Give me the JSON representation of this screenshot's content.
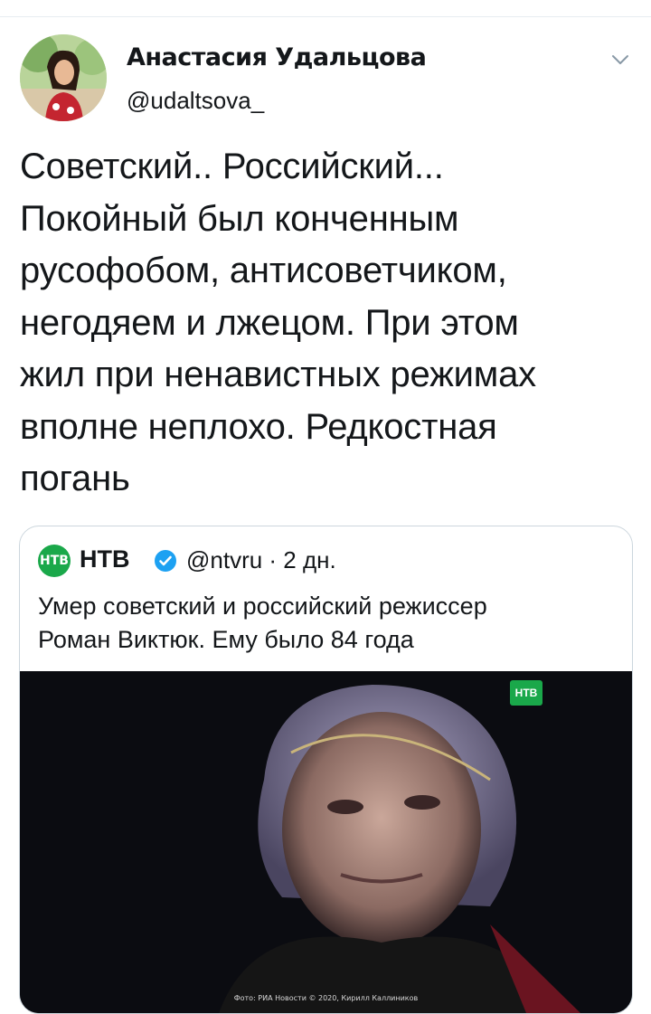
{
  "tweet": {
    "author_name": "Анастасия Удальцова",
    "author_handle": "@udaltsova_",
    "text": "Советский.. Российский...\nПокойный был конченным\nрусофобом, антисоветчиком,\nнегодяем и лжецом. При этом\nжил при ненавистных режимах\nвполне неплохо. Редкостная\nпогань",
    "menu_icon": "chevron-down-icon"
  },
  "quoted_tweet": {
    "logo_text": "НТВ",
    "author_name": "НТВ",
    "verified_icon": "verified-badge-icon",
    "meta": "@ntvru · 2 дн.",
    "text": "Умер советский и российский режиссер\nРоман Виктюк. Ему было 84 года",
    "image_watermark": "НТВ",
    "photo_credit": "Фото: РИА Новости © 2020, Кирилл Каллиников"
  },
  "colors": {
    "text": "#14171a",
    "border": "#ccd6dd",
    "ntv_green": "#1aa84a",
    "verified_blue": "#1da1f2"
  }
}
